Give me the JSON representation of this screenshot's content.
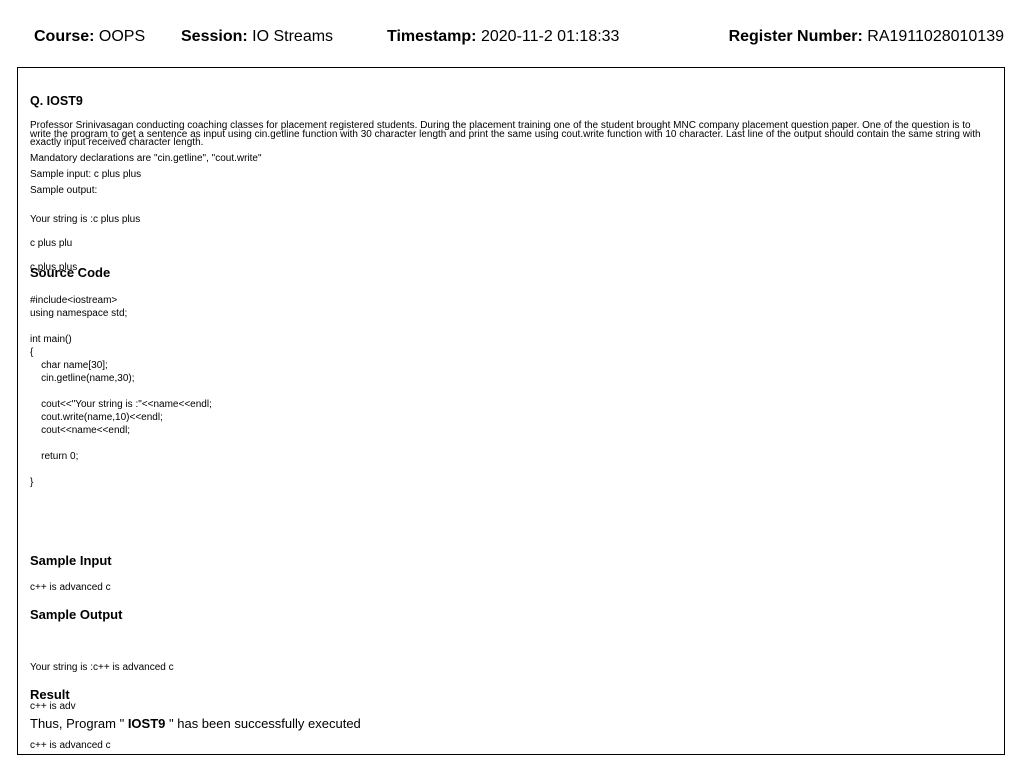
{
  "header": {
    "course_label": "Course:",
    "course_value": "OOPS",
    "session_label": "Session:",
    "session_value": "IO Streams",
    "timestamp_label": "Timestamp:",
    "timestamp_value": "2020-11-2 01:18:33",
    "register_label": "Register Number:",
    "register_value": "RA1911028010139"
  },
  "question": {
    "title": "Q. IOST9",
    "description": "Professor Srinivasagan conducting coaching classes for placement registered students. During the placement training one of the student brought MNC company placement question paper. One of the question is to write the program to get a sentence as input using cin.getline function with 30 character length and print the same using cout.write function with 10 character. Last line of the output should contain the same string with exactly input received character length.",
    "mandatory": "Mandatory declarations are \"cin.getline\", \"cout.write\"",
    "sample_input_line": "Sample input: c plus plus",
    "sample_output_label": "Sample output:",
    "sample_output_lines": [
      "Your string is :c plus plus",
      "c plus plu",
      "c plus plus"
    ]
  },
  "source": {
    "heading": "Source Code",
    "code": "#include<iostream>\nusing namespace std;\n\nint main()\n{\n    char name[30];\n    cin.getline(name,30);\n\n    cout<<\"Your string is :\"<<name<<endl;\n    cout.write(name,10)<<endl;\n    cout<<name<<endl;\n\n    return 0;\n\n}"
  },
  "sample_input": {
    "heading": "Sample Input",
    "text": "c++ is advanced c"
  },
  "sample_output": {
    "heading": "Sample Output",
    "lines": [
      "Your string is :c++ is advanced c",
      "c++ is adv",
      "c++ is advanced c"
    ]
  },
  "result": {
    "heading": "Result",
    "prefix": "Thus, Program \" ",
    "program": "IOST9",
    "suffix": " \" has been successfully executed"
  }
}
